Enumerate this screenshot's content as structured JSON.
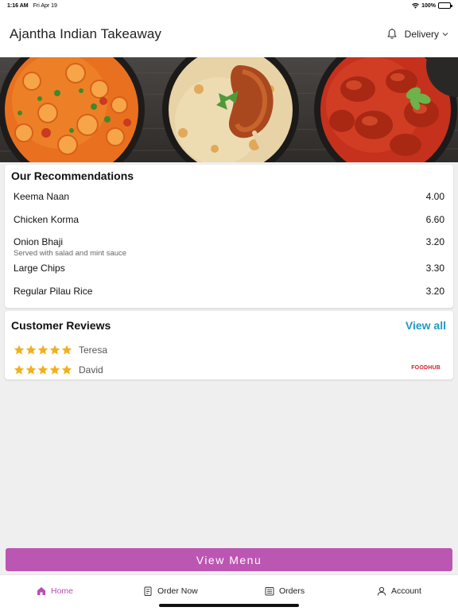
{
  "status_bar": {
    "time": "1:16 AM",
    "date": "Fri Apr 19",
    "battery": "100%"
  },
  "header": {
    "title": "Ajantha Indian Takeaway",
    "delivery_label": "Delivery"
  },
  "recommendations": {
    "title": "Our Recommendations",
    "items": [
      {
        "name": "Keema Naan",
        "price": "4.00"
      },
      {
        "name": "Chicken Korma",
        "price": "6.60"
      },
      {
        "name": "Onion Bhaji",
        "price": "3.20",
        "description": "Served with salad and mint sauce"
      },
      {
        "name": "Large Chips",
        "price": "3.30"
      },
      {
        "name": "Regular Pilau Rice",
        "price": "3.20"
      }
    ]
  },
  "reviews": {
    "title": "Customer Reviews",
    "view_all": "View all",
    "items": [
      {
        "name": "Teresa",
        "rating": 5
      },
      {
        "name": "David",
        "rating": 5
      }
    ],
    "source_logo": "FOODHUB"
  },
  "view_menu_label": "View Menu",
  "tabs": [
    {
      "label": "Home",
      "icon": "home-icon",
      "active": true
    },
    {
      "label": "Order Now",
      "icon": "order-icon",
      "active": false
    },
    {
      "label": "Orders",
      "icon": "orders-icon",
      "active": false
    },
    {
      "label": "Account",
      "icon": "account-icon",
      "active": false
    }
  ],
  "colors": {
    "accent": "#bc56b3",
    "link": "#1f9ac4",
    "star": "#f2b01e",
    "foodhub": "#d81e2a"
  }
}
